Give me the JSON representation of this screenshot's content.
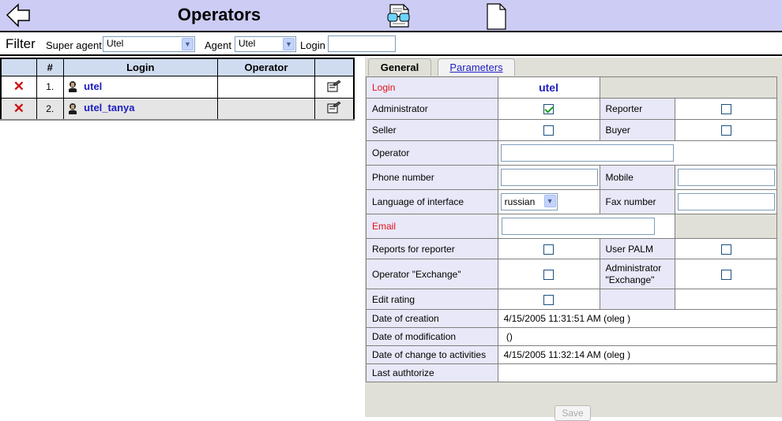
{
  "header": {
    "title": "Operators",
    "back_icon": "back-arrow-icon",
    "view_icon": "glasses-document-icon",
    "new_icon": "blank-document-icon"
  },
  "filter": {
    "label": "Filter",
    "super_agent_label": "Super agent",
    "super_agent_value": "Utel",
    "agent_label": "Agent",
    "agent_value": "Utel",
    "login_label": "Login",
    "login_value": ""
  },
  "list": {
    "columns": [
      "",
      "#",
      "Login",
      "Operator",
      ""
    ],
    "rows": [
      {
        "num": "1.",
        "login": "utel",
        "operator": ""
      },
      {
        "num": "2.",
        "login": "utel_tanya",
        "operator": ""
      }
    ]
  },
  "tabs": {
    "general": "General",
    "parameters": "Parameters"
  },
  "form": {
    "login_label": "Login",
    "login_value": "utel",
    "administrator_label": "Administrator",
    "administrator_checked": true,
    "reporter_label": "Reporter",
    "reporter_checked": false,
    "seller_label": "Seller",
    "seller_checked": false,
    "buyer_label": "Buyer",
    "buyer_checked": false,
    "operator_label": "Operator",
    "operator_value": "",
    "phone_label": "Phone number",
    "phone_value": "",
    "mobile_label": "Mobile",
    "mobile_value": "",
    "language_label": "Language of interface",
    "language_value": "russian",
    "fax_label": "Fax number",
    "fax_value": "",
    "email_label": "Email",
    "email_value": "",
    "reports_label": "Reports for reporter",
    "reports_checked": false,
    "palm_label": "User PALM",
    "palm_checked": false,
    "op_exchange_label": "Operator \"Exchange\"",
    "op_exchange_checked": false,
    "admin_exchange_label": "Administrator \"Exchange\"",
    "admin_exchange_checked": false,
    "edit_rating_label": "Edit rating",
    "edit_rating_checked": false,
    "date_creation_label": "Date of creation",
    "date_creation_value": "4/15/2005 11:31:51 AM (oleg )",
    "date_modification_label": "Date of modification",
    "date_modification_value": " ()",
    "date_activities_label": "Date of change to activities",
    "date_activities_value": "4/15/2005 11:32:14 AM (oleg )",
    "last_auth_label": "Last authtorize",
    "last_auth_value": ""
  },
  "save_label": "Save",
  "colors": {
    "header_bg": "#ccccf4",
    "required_label": "#e0111b",
    "link": "#1d1dc2",
    "delete_icon": "#cc1111"
  }
}
